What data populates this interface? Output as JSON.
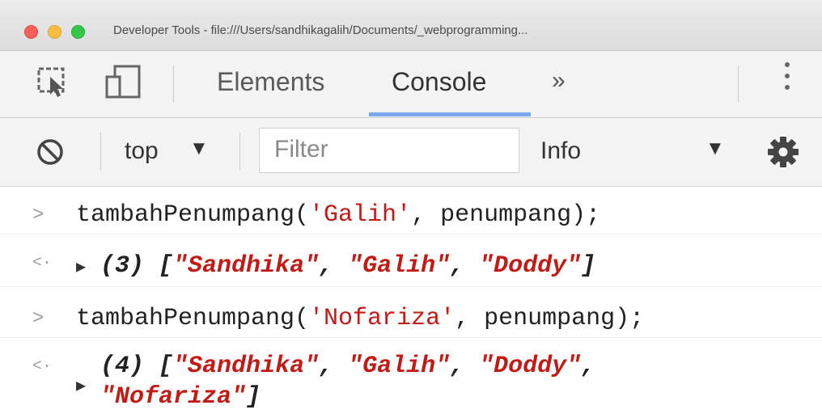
{
  "window": {
    "title": "Developer Tools - file:///Users/sandhikagalih/Documents/_webprogramming..."
  },
  "tabs": {
    "items": [
      {
        "label": "Elements",
        "active": false
      },
      {
        "label": "Console",
        "active": true
      }
    ],
    "overflow_label": "»"
  },
  "console_toolbar": {
    "context_label": "top",
    "context_caret": "▼",
    "filter_placeholder": "Filter",
    "level_label": "Info",
    "level_caret": "▼"
  },
  "console": {
    "entries": [
      {
        "type": "input",
        "prompt": ">",
        "func": "tambahPenumpang(",
        "arg": "'Galih'",
        "rest": ", penumpang);"
      },
      {
        "type": "output",
        "prompt": "<·",
        "count": "(3)",
        "items": [
          "\"Sandhika\"",
          "\"Galih\"",
          "\"Doddy\""
        ]
      },
      {
        "type": "input",
        "prompt": ">",
        "func": "tambahPenumpang(",
        "arg": "'Nofariza'",
        "rest": ", penumpang);"
      },
      {
        "type": "output",
        "prompt": "<·",
        "count": "(4)",
        "items": [
          "\"Sandhika\"",
          "\"Galih\"",
          "\"Doddy\"",
          "\"Nofariza\""
        ]
      }
    ]
  },
  "colors": {
    "string": "#c41a16",
    "tab_underline": "#7aa9f0"
  },
  "icons": [
    "inspect-element-icon",
    "device-toggle-icon",
    "clear-console-icon",
    "settings-gear-icon",
    "kebab-menu-icon"
  ]
}
